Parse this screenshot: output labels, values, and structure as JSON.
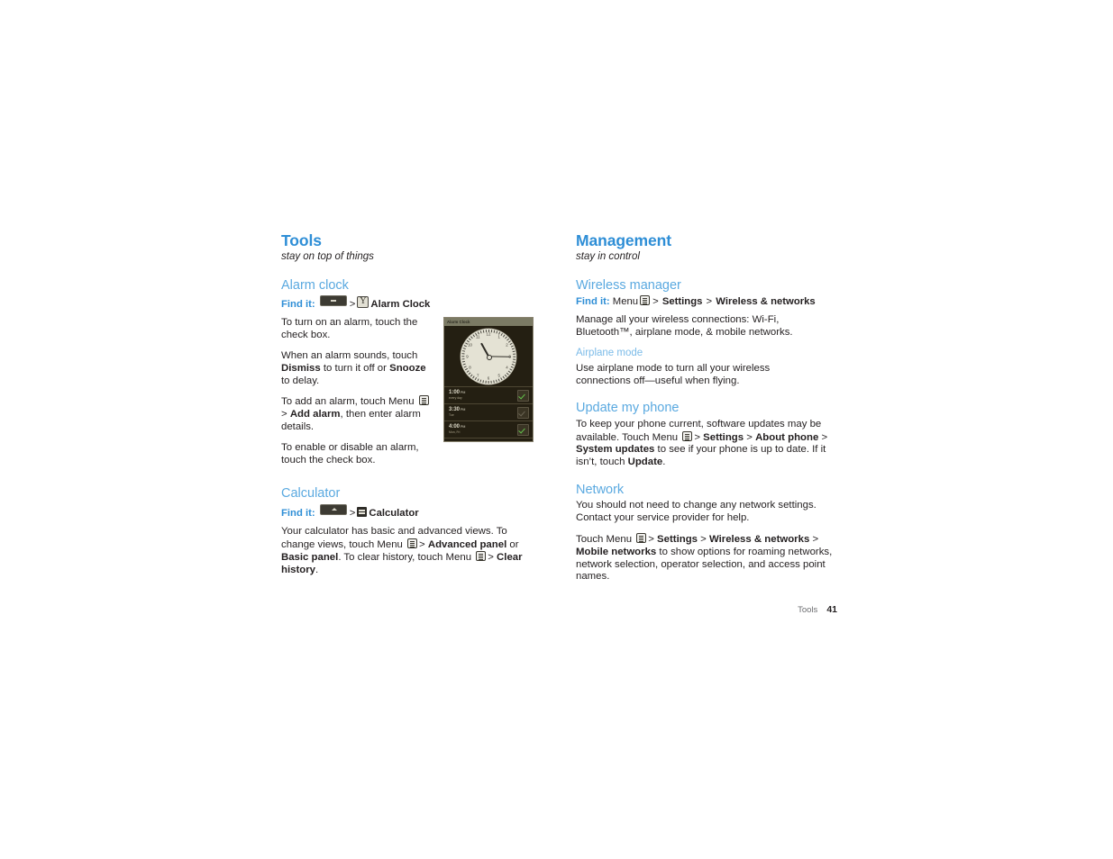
{
  "page": {
    "footer_section": "Tools",
    "footer_page_number": "41",
    "accent_title": "#2e8ed6",
    "accent_heading": "#5aa9e0",
    "accent_subheading": "#7bbbe8"
  },
  "left_column": {
    "title": "Tools",
    "subtitle": "stay on top of things",
    "alarm_clock": {
      "heading": "Alarm clock",
      "find_it_label": "Find it:",
      "find_it_gt1": ">",
      "find_it_app": "Alarm Clock",
      "p1": "To turn on an alarm, touch the check box.",
      "p2_a": "When an alarm sounds, touch ",
      "p2_b": "Dismiss",
      "p2_c": " to turn it off or ",
      "p2_d": "Snooze",
      "p2_e": " to delay.",
      "p3_a": "To add an alarm, touch Menu ",
      "p3_gt": "> ",
      "p3_b": "Add alarm",
      "p3_c": ", then enter alarm details.",
      "p4": "To enable or disable an alarm, touch the check box."
    },
    "calculator": {
      "heading": "Calculator",
      "find_it_label": "Find it:",
      "find_it_gt1": ">",
      "find_it_app": "Calculator",
      "p1_a": "Your calculator has basic and advanced views. To change views, touch Menu ",
      "p1_gt": "> ",
      "p1_b": "Advanced panel",
      "p1_c": " or ",
      "p1_d": "Basic panel",
      "p1_e": ". To clear history, touch Menu ",
      "p1_gt2": "> ",
      "p1_f": "Clear history",
      "p1_g": "."
    }
  },
  "right_column": {
    "title": "Management",
    "subtitle": "stay in control",
    "wireless_manager": {
      "heading": "Wireless manager",
      "find_it_label": "Find it:",
      "find_it_menu": "Menu",
      "find_it_gt1": ">",
      "find_it_settings": "Settings",
      "find_it_gt2": ">",
      "find_it_target": "Wireless & networks",
      "p1": "Manage all your wireless connections: Wi-Fi, Bluetooth™, airplane mode, & mobile networks."
    },
    "airplane_mode": {
      "subheading": "Airplane mode",
      "p1": "Use airplane mode to turn all your wireless connections off—useful when flying."
    },
    "update_my_phone": {
      "heading": "Update my phone",
      "p1_a": "To keep your phone current, software updates may be available. Touch Menu ",
      "p1_gt1": "> ",
      "p1_b": "Settings",
      "p1_gt2": " > ",
      "p1_c": "About phone",
      "p1_gt3": "> ",
      "p1_d": "System updates",
      "p1_e": " to see if your phone is up to date. If it isn’t, touch ",
      "p1_f": "Update",
      "p1_g": "."
    },
    "network": {
      "heading": "Network",
      "p1": "You should not need to change any network settings. Contact your service provider for help.",
      "p2_a": "Touch Menu ",
      "p2_gt1": "> ",
      "p2_b": "Settings",
      "p2_gt2": " > ",
      "p2_c": "Wireless & networks",
      "p2_gt3": "> ",
      "p2_d": "Mobile networks",
      "p2_e": " to show options for roaming networks, network selection, operator selection, and access point names."
    }
  },
  "phone_screenshot": {
    "title_bar": "Alarm Clock",
    "clock_numbers": [
      "12",
      "1",
      "2",
      "3",
      "4",
      "5",
      "6",
      "7",
      "8",
      "9",
      "10",
      "11"
    ],
    "alarms": [
      {
        "time": "1:00",
        "ampm": "PM",
        "days": "every day",
        "enabled": "on"
      },
      {
        "time": "3:30",
        "ampm": "PM",
        "days": "Tue",
        "enabled": "off"
      },
      {
        "time": "4:00",
        "ampm": "PM",
        "days": "Mon, Fri",
        "enabled": "on"
      }
    ]
  }
}
